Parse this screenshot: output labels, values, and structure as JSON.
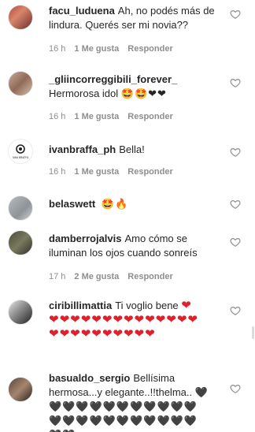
{
  "comments": [
    {
      "username": "facu_luduena",
      "text": "Ah, no podés más de lindura. Querés ser mi novia??",
      "time": "16 h",
      "likes": "1 Me gusta",
      "reply": "Responder",
      "avatar_icon": "user-avatar-photo"
    },
    {
      "username": "_gliincorreggibili_forever_",
      "text": "Hermorosa idol",
      "emojis": "🤩🤩❤❤",
      "time": "16 h",
      "likes": "1 Me gusta",
      "reply": "Responder",
      "avatar_icon": "user-avatar-photo"
    },
    {
      "username": "ivanbraffa_ph",
      "text": "Bella!",
      "time": "16 h",
      "likes": "1 Me gusta",
      "reply": "Responder",
      "avatar_icon": "camera-logo-avatar",
      "avatar_text": "IVAN BRAFFA"
    },
    {
      "username": "belaswett",
      "text": "",
      "emojis": "🤩🔥",
      "avatar_icon": "user-avatar-photo"
    },
    {
      "username": "damberrojalvis",
      "text": "Amo cómo se iluminan los ojos cuando sonreís",
      "time": "17 h",
      "likes": "2 Me gusta",
      "reply": "Responder",
      "avatar_icon": "user-avatar-photo"
    },
    {
      "username": "ciribillimattia",
      "text": "Ti voglio bene",
      "emojis": "❤❤❤❤❤❤❤❤❤❤❤❤❤❤❤❤❤❤❤❤❤❤❤❤❤",
      "avatar_icon": "user-avatar-photo"
    },
    {
      "username": "basualdo_sergio",
      "text": "Bellísima hermosa...y elegante..!!thelma..",
      "emojis": "🖤🖤🖤🖤🖤🖤🖤🖤🖤🖤🖤🖤🖤🖤🖤🖤🖤🖤🖤🖤🖤🖤🖤🖤🖤",
      "avatar_icon": "user-avatar-photo"
    }
  ],
  "colors": {
    "text": "#262626",
    "meta": "#8e8e8e",
    "heart_red": "#e0202a"
  }
}
